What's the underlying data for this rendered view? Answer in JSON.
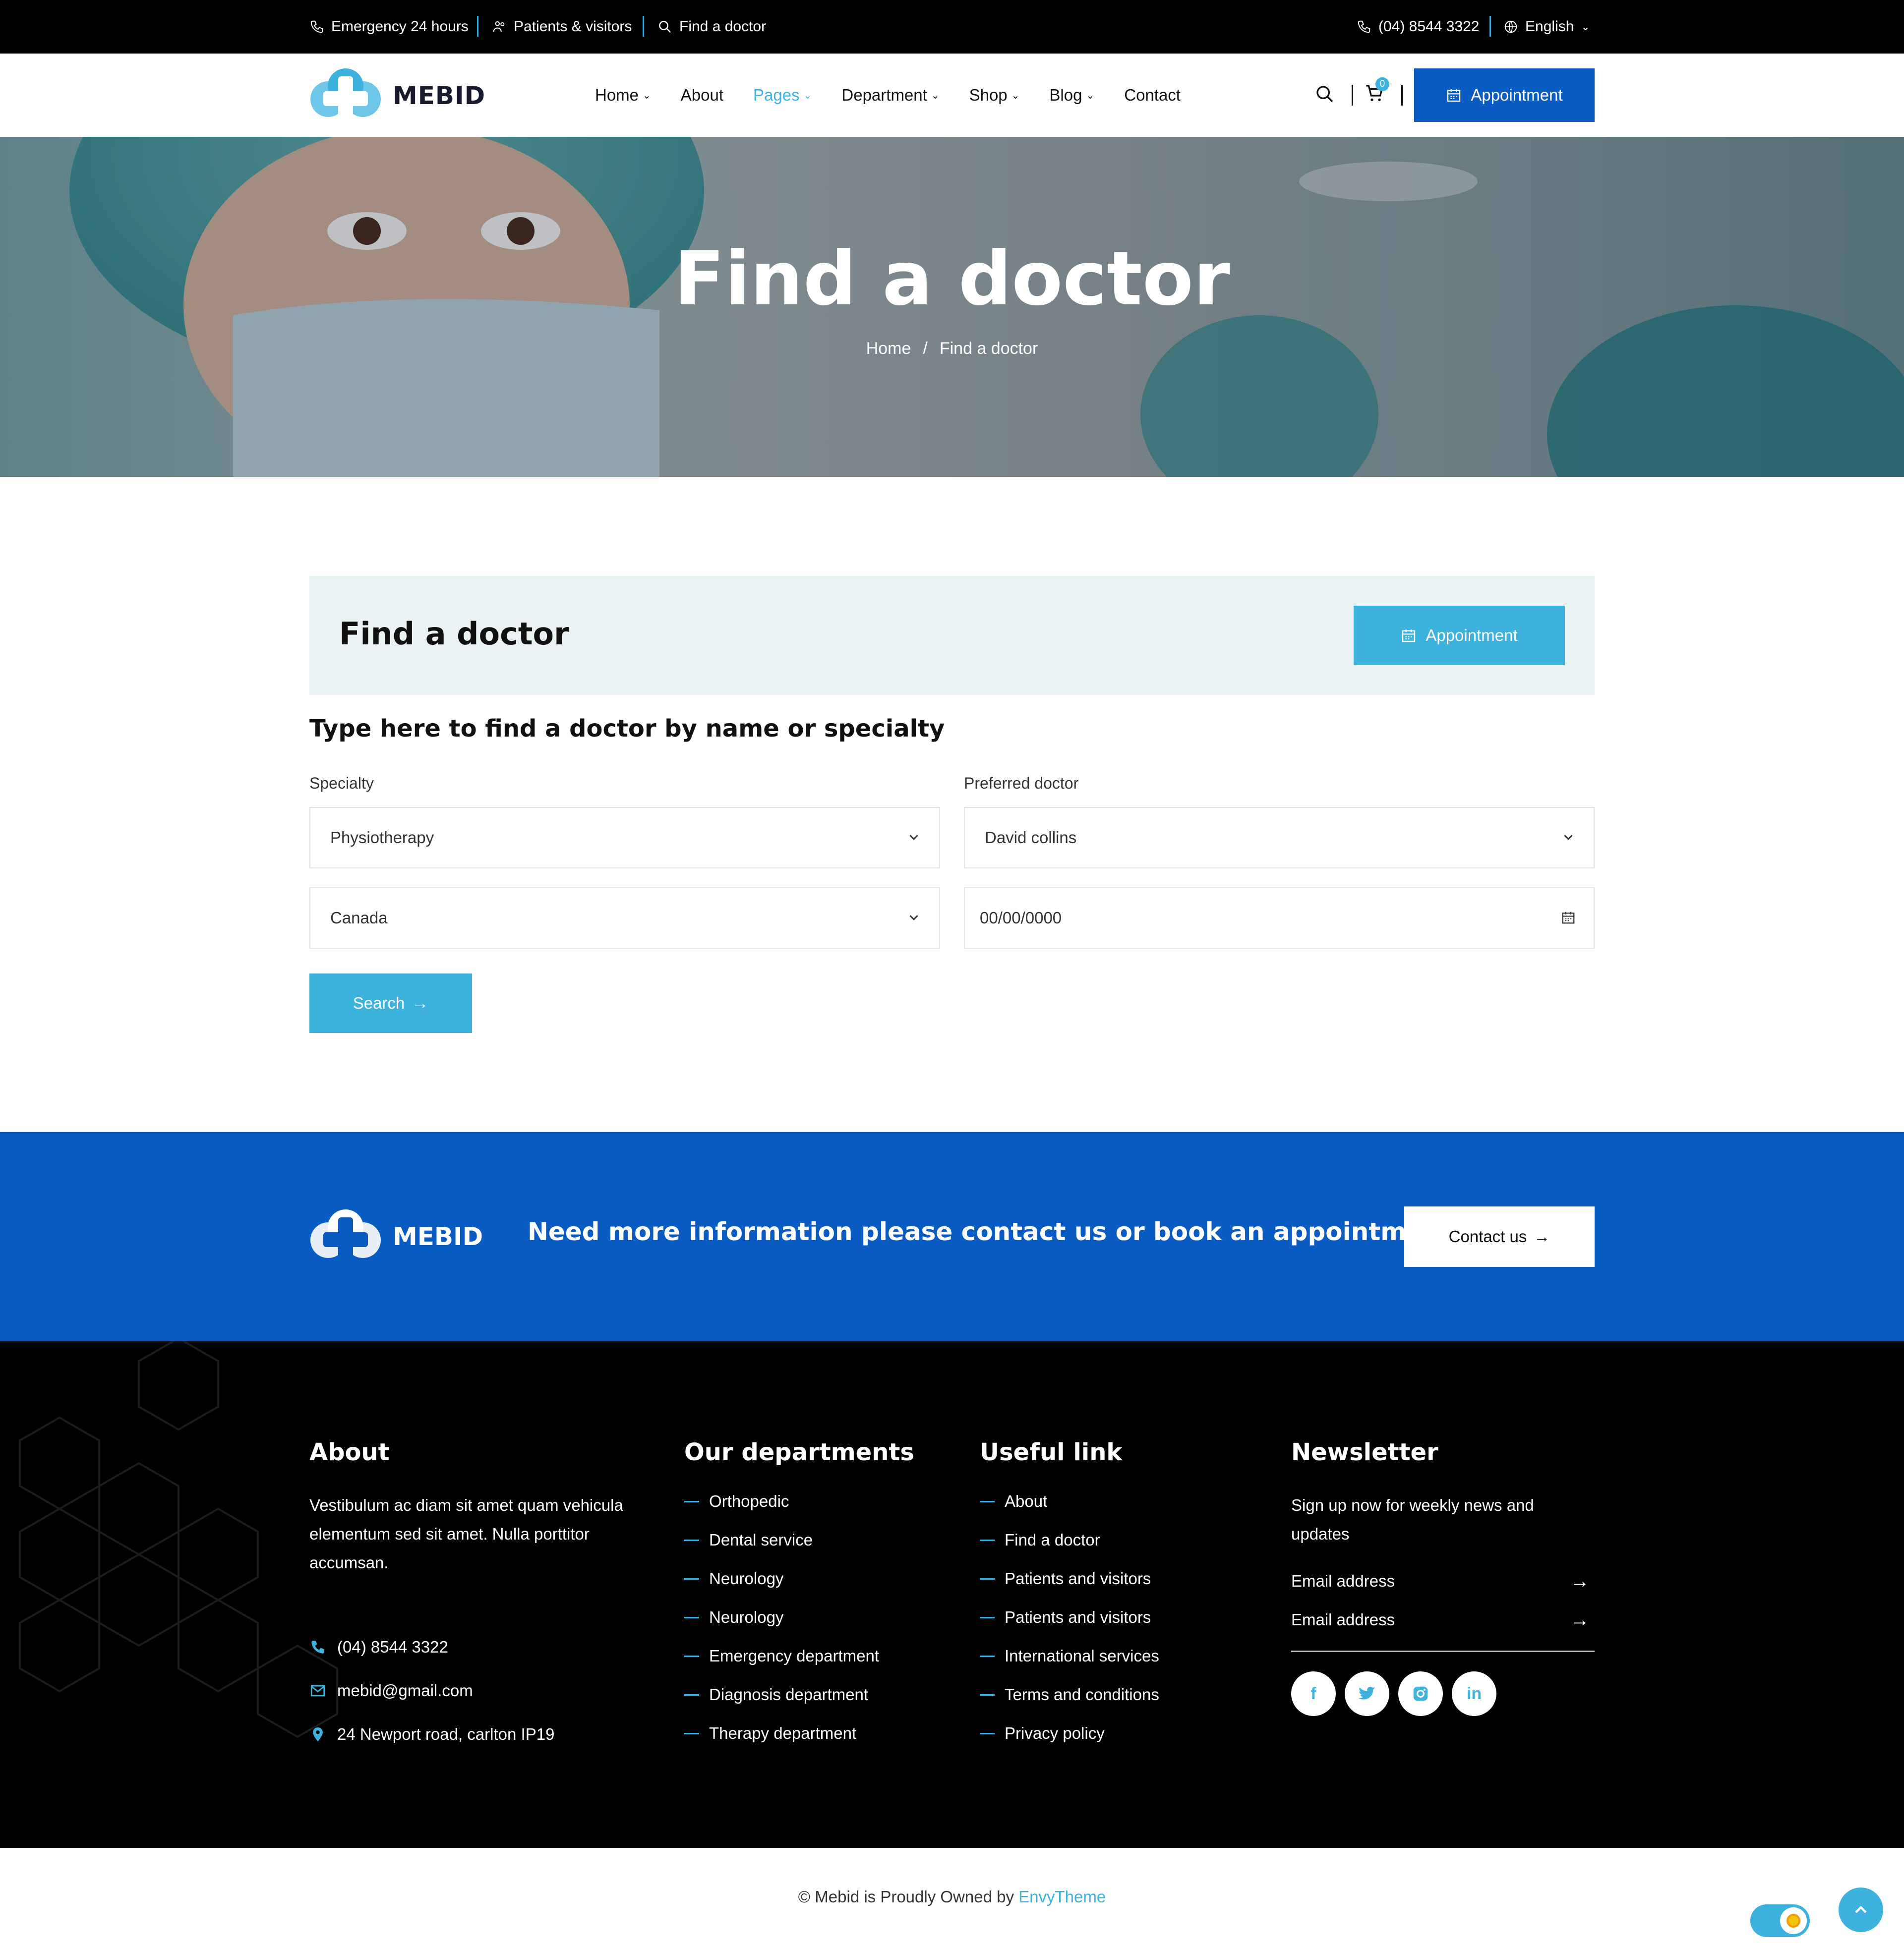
{
  "topbar": {
    "emergency": "Emergency 24 hours",
    "patients": "Patients & visitors",
    "find_doctor": "Find a doctor",
    "phone": "(04) 8544 3322",
    "language": "English"
  },
  "header": {
    "brand": "MEBID",
    "nav": [
      "Home",
      "About",
      "Pages",
      "Department",
      "Shop",
      "Blog",
      "Contact"
    ],
    "active_nav": "Pages",
    "cart_count": "0",
    "appointment_label": "Appointment"
  },
  "hero": {
    "title": "Find a doctor",
    "breadcrumb": [
      "Home",
      "/",
      "Find a doctor"
    ]
  },
  "finder": {
    "box_title": "Find a doctor",
    "appointment_label": "Appointment",
    "heading": "Type here to find a doctor by name or specialty",
    "specialty_label": "Specialty",
    "specialty_value": "Physiotherapy",
    "doctor_label": "Preferred doctor",
    "doctor_value": "David collins",
    "location_value": "Canada",
    "date_placeholder": "00/00/0000",
    "search_label": "Search"
  },
  "cta": {
    "brand": "MEBID",
    "text": "Need more information please contact us or book an appointment",
    "button": "Contact us"
  },
  "footer": {
    "about": {
      "title": "About",
      "text": "Vestibulum ac diam sit amet quam vehicula elementum sed sit amet. Nulla porttitor accumsan.",
      "phone": "(04) 8544 3322",
      "email": "mebid@gmail.com",
      "address": "24 Newport road, carlton IP19"
    },
    "departments": {
      "title": "Our departments",
      "items": [
        "Orthopedic",
        "Dental service",
        "Neurology",
        "Neurology",
        "Emergency department",
        "Diagnosis department",
        "Therapy department"
      ]
    },
    "useful": {
      "title": "Useful link",
      "items": [
        "About",
        "Find a doctor",
        "Patients and visitors",
        "Patients and visitors",
        "International services",
        "Terms and conditions",
        "Privacy policy"
      ]
    },
    "newsletter": {
      "title": "Newsletter",
      "text": "Sign up now for weekly news and updates",
      "field1": "Email address",
      "field2": "Email address"
    },
    "social": [
      "facebook-icon",
      "twitter-icon",
      "instagram-icon",
      "linkedin-icon"
    ]
  },
  "bottom": {
    "copyright_prefix": "© Mebid is Proudly Owned by",
    "owner": "EnvyTheme"
  },
  "colors": {
    "primary": "#0a5cc2",
    "accent": "#3db2dc",
    "finder_bg": "#ebf2f4",
    "dark": "#000000"
  }
}
